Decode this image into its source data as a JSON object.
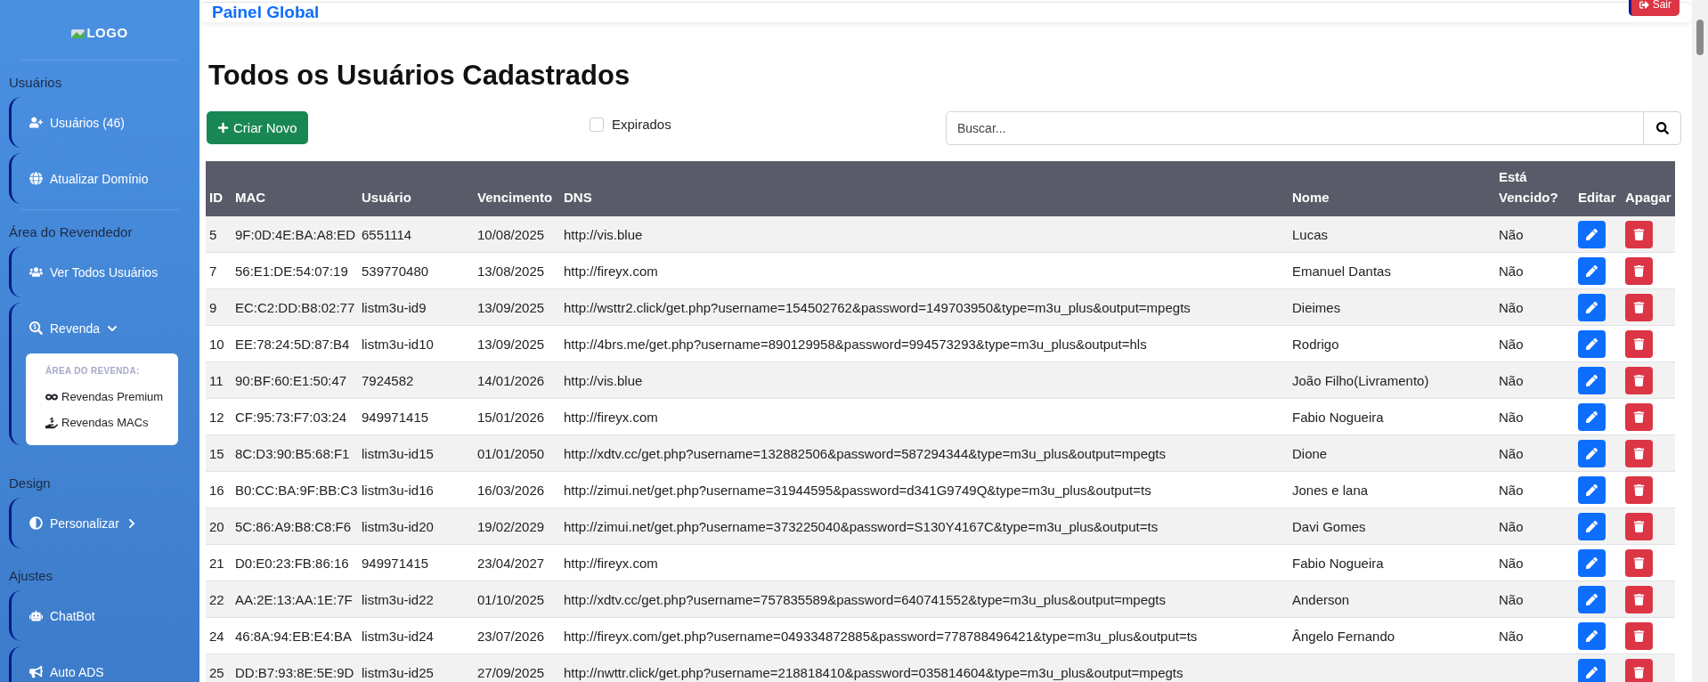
{
  "sidebar": {
    "logo": "LOGO",
    "sections": [
      {
        "title": "Usuários",
        "items": [
          {
            "kind": "link",
            "label": "Usuários (46)"
          },
          {
            "kind": "link",
            "label": "Atualizar Domínio"
          }
        ]
      },
      {
        "title": "Área do Revendedor",
        "items": [
          {
            "kind": "link",
            "label": "Ver Todos Usuários"
          },
          {
            "kind": "dropdown",
            "label": "Revenda",
            "expanded": true,
            "submenu": {
              "heading": "ÁREA DO REVENDA:",
              "items": [
                "Revendas Premium",
                "Revendas MACs"
              ]
            }
          }
        ]
      },
      {
        "title": "Design",
        "items": [
          {
            "kind": "dropdown",
            "label": "Personalizar",
            "expanded": false
          }
        ]
      },
      {
        "title": "Ajustes",
        "items": [
          {
            "kind": "link",
            "label": "ChatBot"
          },
          {
            "kind": "link",
            "label": "Auto ADS"
          }
        ]
      }
    ]
  },
  "topbar": {
    "title": "Painel Global",
    "logout": "Sair"
  },
  "page_title": "Todos os Usuários Cadastrados",
  "toolbar": {
    "create": "Criar Novo",
    "filter": {
      "label": "Expirados",
      "checked": false
    },
    "search": {
      "placeholder": "Buscar..."
    }
  },
  "table": {
    "columns": [
      "ID",
      "MAC",
      "Usuário",
      "Vencimento",
      "DNS",
      "Nome",
      "Está Vencido?",
      "Editar",
      "Apagar"
    ],
    "rows": [
      {
        "id": "5",
        "mac": "9F:0D:4E:BA:A8:ED",
        "user": "6551114",
        "due": "10/08/2025",
        "dns": "http://vis.blue",
        "name": "Lucas",
        "expired": "Não"
      },
      {
        "id": "7",
        "mac": "56:E1:DE:54:07:19",
        "user": "539770480",
        "due": "13/08/2025",
        "dns": "http://fireyx.com",
        "name": "Emanuel Dantas",
        "expired": "Não"
      },
      {
        "id": "9",
        "mac": "EC:C2:DD:B8:02:77",
        "user": "listm3u-id9",
        "due": "13/09/2025",
        "dns": "http://wsttr2.click/get.php?username=154502762&password=149703950&type=m3u_plus&output=mpegts",
        "name": "Dieimes",
        "expired": "Não"
      },
      {
        "id": "10",
        "mac": "EE:78:24:5D:87:B4",
        "user": "listm3u-id10",
        "due": "13/09/2025",
        "dns": "http://4brs.me/get.php?username=890129958&password=994573293&type=m3u_plus&output=hls",
        "name": "Rodrigo",
        "expired": "Não"
      },
      {
        "id": "11",
        "mac": "90:BF:60:E1:50:47",
        "user": "7924582",
        "due": "14/01/2026",
        "dns": "http://vis.blue",
        "name": "João Filho(Livramento)",
        "expired": "Não"
      },
      {
        "id": "12",
        "mac": "CF:95:73:F7:03:24",
        "user": "949971415",
        "due": "15/01/2026",
        "dns": "http://fireyx.com",
        "name": "Fabio Nogueira",
        "expired": "Não"
      },
      {
        "id": "15",
        "mac": "8C:D3:90:B5:68:F1",
        "user": "listm3u-id15",
        "due": "01/01/2050",
        "dns": "http://xdtv.cc/get.php?username=132882506&password=587294344&type=m3u_plus&output=mpegts",
        "name": "Dione",
        "expired": "Não"
      },
      {
        "id": "16",
        "mac": "B0:CC:BA:9F:BB:C3",
        "user": "listm3u-id16",
        "due": "16/03/2026",
        "dns": "http://zimui.net/get.php?username=31944595&password=d341G9749Q&type=m3u_plus&output=ts",
        "name": "Jones e lana",
        "expired": "Não"
      },
      {
        "id": "20",
        "mac": "5C:86:A9:B8:C8:F6",
        "user": "listm3u-id20",
        "due": "19/02/2029",
        "dns": "http://zimui.net/get.php?username=373225040&password=S130Y4167C&type=m3u_plus&output=ts",
        "name": "Davi Gomes",
        "expired": "Não"
      },
      {
        "id": "21",
        "mac": "D0:E0:23:FB:86:16",
        "user": "949971415",
        "due": "23/04/2027",
        "dns": "http://fireyx.com",
        "name": "Fabio Nogueira",
        "expired": "Não"
      },
      {
        "id": "22",
        "mac": "AA:2E:13:AA:1E:7F",
        "user": "listm3u-id22",
        "due": "01/10/2025",
        "dns": "http://xdtv.cc/get.php?username=757835589&password=640741552&type=m3u_plus&output=mpegts",
        "name": "Anderson",
        "expired": "Não"
      },
      {
        "id": "24",
        "mac": "46:8A:94:EB:E4:BA",
        "user": "listm3u-id24",
        "due": "23/07/2026",
        "dns": "http://fireyx.com/get.php?username=049334872885&password=778788496421&type=m3u_plus&output=ts",
        "name": "Ângelo Fernando",
        "expired": "Não"
      },
      {
        "id": "25",
        "mac": "DD:B7:93:8E:5E:9D",
        "user": "listm3u-id25",
        "due": "27/09/2025",
        "dns": "http://nwttr.click/get.php?username=218818410&password=035814604&type=m3u_plus&output=mpegts"
      }
    ]
  }
}
